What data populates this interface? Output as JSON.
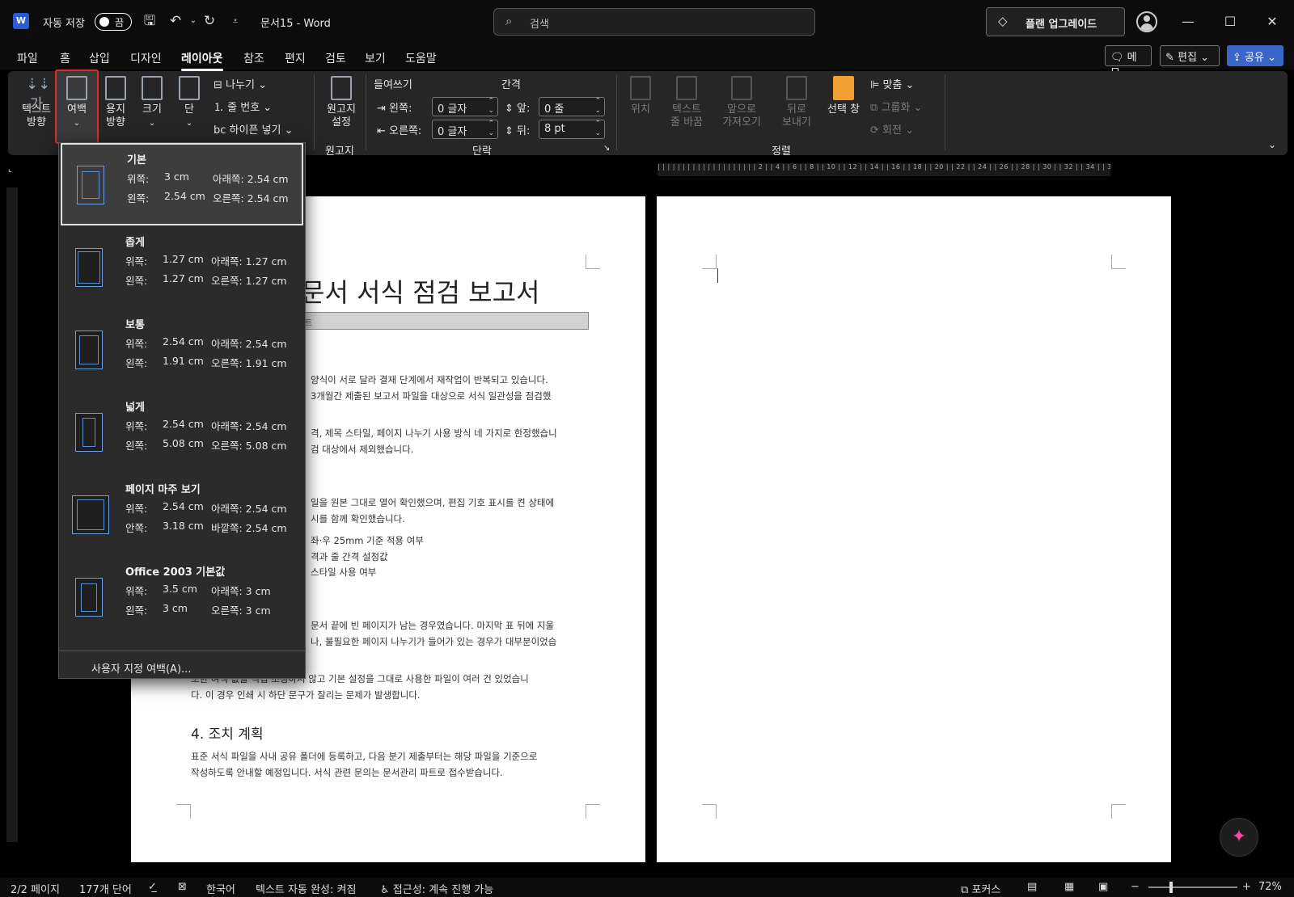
{
  "titlebar": {
    "logo": "W",
    "autosave_label": "자동 저장",
    "autosave_state": "끔",
    "doc_title": "문서15  -  Word",
    "search_placeholder": "검색",
    "upgrade_label": "플랜 업그레이드",
    "minimize": "—",
    "maximize": "☐",
    "close": "✕"
  },
  "menu": {
    "tabs": [
      "파일",
      "홈",
      "삽입",
      "디자인",
      "레이아웃",
      "참조",
      "편지",
      "검토",
      "보기",
      "도움말"
    ],
    "active_tab": "레이아웃",
    "memo": "메모",
    "edit": "편집",
    "share": "공유"
  },
  "ribbon": {
    "text_direction": "텍스트\n방향",
    "margins": "여백",
    "orientation": "용지\n방향",
    "size": "크기",
    "columns": "단",
    "breaks": "나누기",
    "line_numbers": "줄 번호",
    "hyphenation": "하이픈 넣기",
    "manuscript": "원고지\n설정",
    "manuscript_group": "원고지",
    "indent_label": "들여쓰기",
    "spacing_label": "간격",
    "indent_left_label": "왼쪽:",
    "indent_left_value": "0 글자",
    "indent_right_label": "오른쪽:",
    "indent_right_value": "0 글자",
    "spacing_before_label": "앞:",
    "spacing_before_value": "0 줄",
    "spacing_after_label": "뒤:",
    "spacing_after_value": "8 pt",
    "paragraph_group": "단락",
    "position": "위치",
    "wrap_text": "텍스트\n줄 바꿈",
    "bring_forward": "앞으로\n가져오기",
    "send_backward": "뒤로\n보내기",
    "selection_pane": "선택 창",
    "align": "맞춤",
    "group": "그룹화",
    "rotate": "회전",
    "arrange_group": "정렬"
  },
  "ruler": {
    "marks": "| | | | | | | | | | | | | | | | | | |  | 2 |  | 4 |  | 6 |  | 8 |  | 10 |  | 12 |  | 14 |  | 16 |  | 18 |  | 20 |  | 22 |  | 24 |  | 26 |  | 28 |  | 30 |  | 32 |  | 34 |  | 36 |  | 38 |  | 40 |  | 42 |"
  },
  "margins_menu": {
    "options": [
      {
        "name": "기본",
        "r1a": "위쪽:",
        "r1b": "3 cm",
        "r1c": "아래쪽: 2.54 cm",
        "r2a": "왼쪽:",
        "r2b": "2.54 cm",
        "r2c": "오른쪽: 2.54 cm"
      },
      {
        "name": "좁게",
        "r1a": "위쪽:",
        "r1b": "1.27 cm",
        "r1c": "아래쪽: 1.27 cm",
        "r2a": "왼쪽:",
        "r2b": "1.27 cm",
        "r2c": "오른쪽: 1.27 cm"
      },
      {
        "name": "보통",
        "r1a": "위쪽:",
        "r1b": "2.54 cm",
        "r1c": "아래쪽: 2.54 cm",
        "r2a": "왼쪽:",
        "r2b": "1.91 cm",
        "r2c": "오른쪽: 1.91 cm"
      },
      {
        "name": "넓게",
        "r1a": "위쪽:",
        "r1b": "2.54 cm",
        "r1c": "아래쪽: 2.54 cm",
        "r2a": "왼쪽:",
        "r2b": "5.08 cm",
        "r2c": "오른쪽: 5.08 cm"
      },
      {
        "name": "페이지 마주 보기",
        "r1a": "위쪽:",
        "r1b": "2.54 cm",
        "r1c": "아래쪽: 2.54 cm",
        "r2a": "안쪽:",
        "r2b": "3.18 cm",
        "r2c": "바깥쪽: 2.54 cm"
      },
      {
        "name": "Office 2003 기본값",
        "r1a": "위쪽:",
        "r1b": "3.5 cm",
        "r1c": "아래쪽: 3 cm",
        "r2a": "왼쪽:",
        "r2b": "3 cm",
        "r2c": "오른쪽: 3 cm"
      }
    ],
    "custom": "사용자 지정 여백(A)..."
  },
  "document": {
    "title": "문서 서식 점검 보고서",
    "bar_text": "트",
    "lines": [
      "양식이 서로 달라 결재 단계에서 재작업이 반복되고 있습니다.",
      "3개월간 제출된 보고서 파일을 대상으로 서식 일관성을 점검했",
      "격, 제목 스타일, 페이지 나누기 사용 방식 네 가지로 한정했습니",
      "검 대상에서 제외했습니다.",
      "일을 원본 그대로 열어 확인했으며, 편집 기호 표시를 켠 상태에",
      "시를 함께 확인했습니다.",
      "좌·우 25mm 기준 적용 여부",
      "격과 줄 간격 설정값",
      "스타일 사용 여부",
      "문서 끝에 빈 페이지가 남는 경우였습니다. 마지막 표 뒤에 지울",
      "나, 불필요한 페이지 나누기가 들어가 있는 경우가 대부분이었습",
      "또한 여백 값을 직접 조정하지 않고 기본 설정을 그대로 사용한 파일이 여러 건 있었습니",
      "다. 이 경우 인쇄 시 하단 문구가 잘리는 문제가 발생합니다.",
      "표준 서식 파일을 사내 공유 폴더에 등록하고, 다음 분기 제출부터는 해당 파일을 기준으로",
      "작성하도록 안내할 예정입니다. 서식 관련 문의는 문서관리 파트로 접수받습니다."
    ],
    "heading4": "4. 조치 계획"
  },
  "status": {
    "page": "2/2 페이지",
    "words": "177개 단어",
    "language": "한국어",
    "autocomplete": "텍스트 자동 완성: 켜짐",
    "accessibility": "접근성: 계속 진행 가능",
    "focus": "포커스",
    "zoom_minus": "−",
    "zoom_plus": "+",
    "zoom": "72%"
  }
}
